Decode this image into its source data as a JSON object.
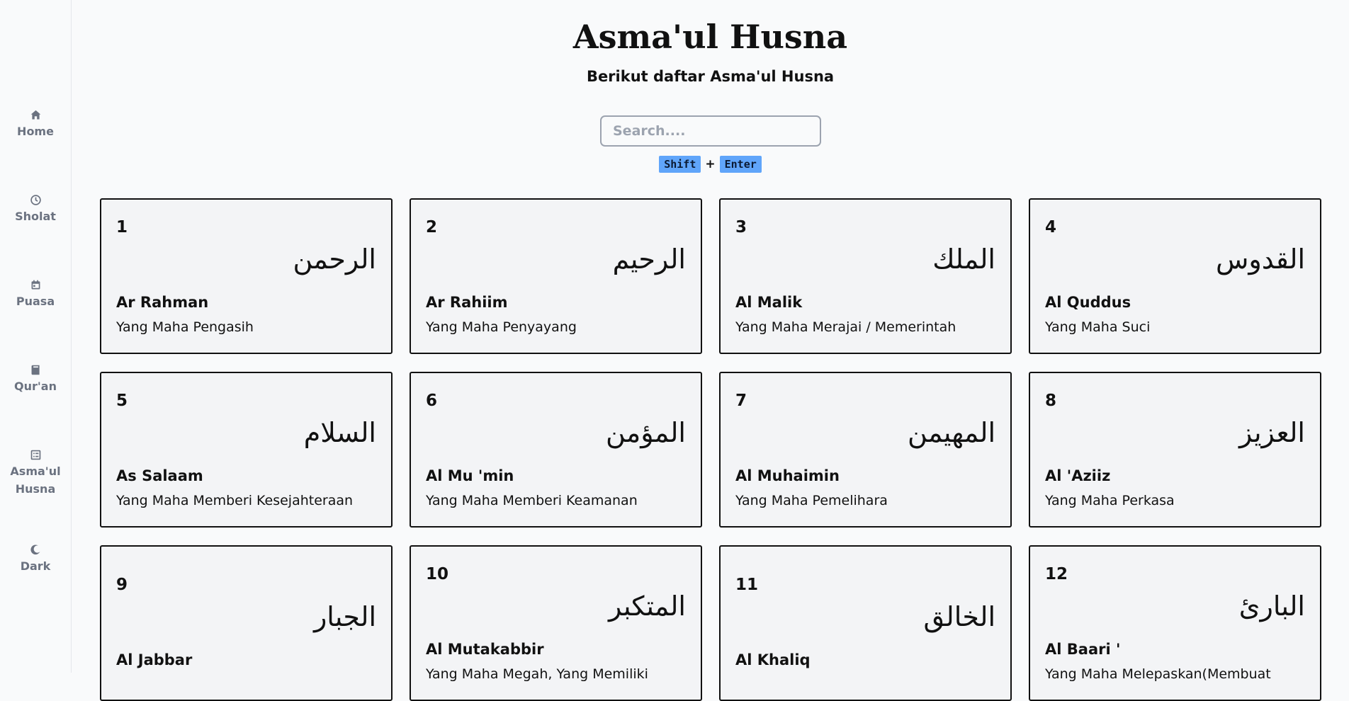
{
  "sidebar": {
    "items": [
      {
        "label": "Home",
        "icon": "home-icon"
      },
      {
        "label": "Sholat",
        "icon": "clock-icon"
      },
      {
        "label": "Puasa",
        "icon": "calendar-icon"
      },
      {
        "label": "Qur'an",
        "icon": "book-icon"
      },
      {
        "label": "Asma'ul Husna",
        "icon": "list-icon"
      },
      {
        "label": "Dark",
        "icon": "moon-icon"
      }
    ]
  },
  "header": {
    "title": "Asma'ul Husna",
    "subtitle": "Berikut daftar Asma'ul Husna"
  },
  "search": {
    "placeholder": "Search....",
    "value": "",
    "shortcut_key1": "Shift",
    "shortcut_plus": "+",
    "shortcut_key2": "Enter"
  },
  "names": [
    {
      "number": "1",
      "arabic": "الرحمن",
      "latin": "Ar Rahman",
      "meaning": "Yang Maha Pengasih"
    },
    {
      "number": "2",
      "arabic": "الرحيم",
      "latin": "Ar Rahiim",
      "meaning": "Yang Maha Penyayang"
    },
    {
      "number": "3",
      "arabic": "الملك",
      "latin": "Al Malik",
      "meaning": "Yang Maha Merajai / Memerintah"
    },
    {
      "number": "4",
      "arabic": "القدوس",
      "latin": "Al Quddus",
      "meaning": "Yang Maha Suci"
    },
    {
      "number": "5",
      "arabic": "السلام",
      "latin": "As Salaam",
      "meaning": "Yang Maha Memberi Kesejahteraan"
    },
    {
      "number": "6",
      "arabic": "المؤمن",
      "latin": "Al Mu 'min",
      "meaning": "Yang Maha Memberi Keamanan"
    },
    {
      "number": "7",
      "arabic": "المهيمن",
      "latin": "Al Muhaimin",
      "meaning": "Yang Maha Pemelihara"
    },
    {
      "number": "8",
      "arabic": "العزيز",
      "latin": "Al 'Aziiz",
      "meaning": "Yang Maha Perkasa"
    },
    {
      "number": "9",
      "arabic": "الجبار",
      "latin": "Al Jabbar",
      "meaning": ""
    },
    {
      "number": "10",
      "arabic": "المتكبر",
      "latin": "Al Mutakabbir",
      "meaning": "Yang Maha Megah, Yang Memiliki"
    },
    {
      "number": "11",
      "arabic": "الخالق",
      "latin": "Al Khaliq",
      "meaning": ""
    },
    {
      "number": "12",
      "arabic": "البارئ",
      "latin": "Al Baari '",
      "meaning": "Yang Maha Melepaskan(Membuat"
    }
  ]
}
